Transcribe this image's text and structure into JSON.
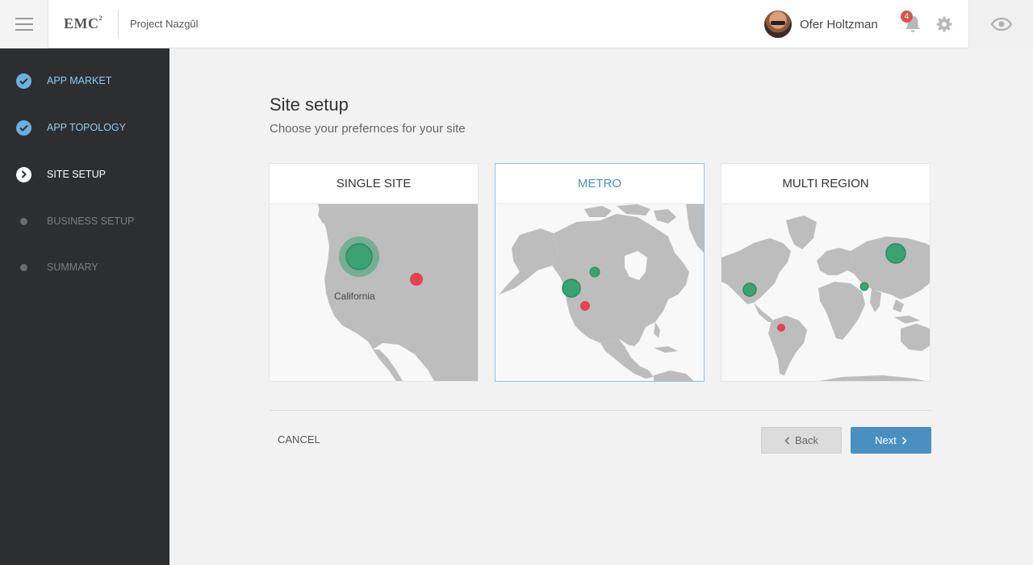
{
  "header": {
    "logo_text": "EMC",
    "logo_sup": "2",
    "project_name": "Project Nazgûl",
    "user_name": "Ofer Holtzman",
    "notification_count": "4",
    "icons": [
      "hamburger-menu-icon",
      "bell-icon",
      "gear-icon",
      "eye-icon"
    ]
  },
  "sidebar": {
    "steps": [
      {
        "label": "APP MARKET",
        "state": "done"
      },
      {
        "label": "APP TOPOLOGY",
        "state": "done"
      },
      {
        "label": "SITE SETUP",
        "state": "current"
      },
      {
        "label": "BUSINESS SETUP",
        "state": "pending"
      },
      {
        "label": "SUMMARY",
        "state": "pending"
      }
    ]
  },
  "main": {
    "title": "Site setup",
    "subtitle": "Choose your prefernces for your site",
    "options": [
      {
        "label": "SINGLE SITE",
        "map_label": "California",
        "selected": false
      },
      {
        "label": "METRO",
        "selected": true
      },
      {
        "label": "MULTI REGION",
        "selected": false
      }
    ],
    "cancel_label": "CANCEL",
    "back_label": "Back",
    "next_label": "Next"
  },
  "colors": {
    "primary_site": "#3aa273",
    "secondary_site": "#e0454f",
    "accent": "#4a8fc2",
    "sidebar_bg": "#2d2e30",
    "done_step": "#6ab1e2"
  }
}
